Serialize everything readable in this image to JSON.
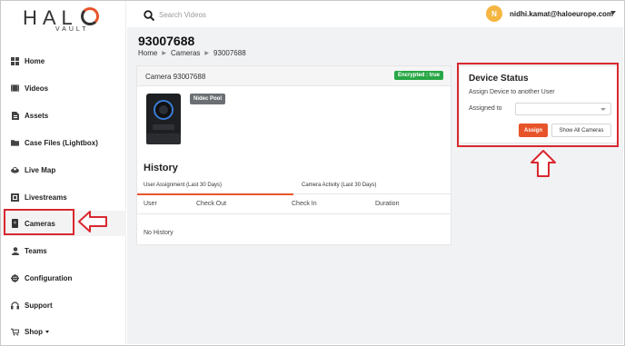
{
  "brand": {
    "logo_text": "HAL",
    "logo_sub": "VAULT",
    "accent": "#e8542a"
  },
  "sidebar": {
    "items": [
      {
        "label": "Home",
        "icon": "grid-icon"
      },
      {
        "label": "Videos",
        "icon": "film-icon"
      },
      {
        "label": "Assets",
        "icon": "document-icon"
      },
      {
        "label": "Case Files (Lightbox)",
        "icon": "folder-icon"
      },
      {
        "label": "Live Map",
        "icon": "map-icon"
      },
      {
        "label": "Livestreams",
        "icon": "livestream-icon"
      },
      {
        "label": "Cameras",
        "icon": "camera-device-icon"
      },
      {
        "label": "Teams",
        "icon": "person-icon"
      },
      {
        "label": "Configuration",
        "icon": "gear-icon"
      },
      {
        "label": "Support",
        "icon": "headset-icon"
      },
      {
        "label": "Shop",
        "icon": "cart-icon"
      }
    ]
  },
  "header": {
    "search_placeholder": "Search Videos",
    "avatar_initial": "N",
    "user_email": "nidhi.kamat@haloeurope.com"
  },
  "page": {
    "title": "93007688",
    "breadcrumb": [
      "Home",
      "Cameras",
      "93007688"
    ]
  },
  "camera_card": {
    "title": "Camera 93007688",
    "encrypted_badge": "Encrypted : true",
    "pool_badge": "Nidec Pool",
    "history_title": "History",
    "tabs": [
      "User Assignment (Last 30 Days)",
      "Camera Activity (Last 30 Days)"
    ],
    "columns": [
      "User",
      "Check Out",
      "Check In",
      "Duration"
    ],
    "empty_text": "No History"
  },
  "device_status": {
    "title": "Device Status",
    "subtitle": "Assign Device to another User",
    "assigned_label": "Assigned to",
    "assigned_value": "",
    "assign_button": "Assign",
    "show_all_button": "Show All Cameras"
  },
  "colors": {
    "annotation": "#d9282f",
    "encrypted": "#27a745",
    "pool_badge": "#6b6f73",
    "avatar": "#f5b642"
  }
}
